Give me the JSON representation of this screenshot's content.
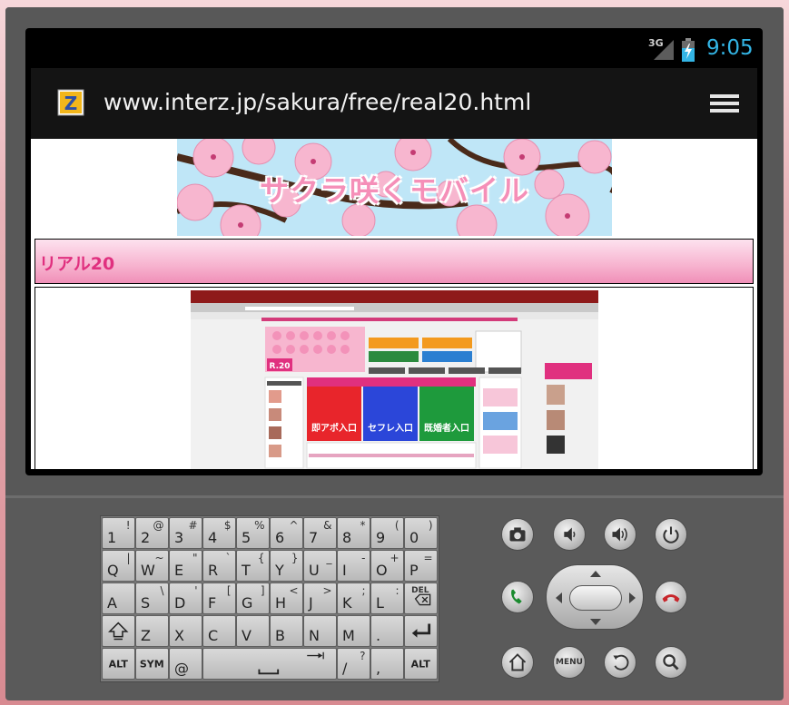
{
  "status_bar": {
    "network": "3G",
    "time": "9:05",
    "clock_color": "#33b5e5"
  },
  "browser": {
    "url": "www.interz.jp/sakura/free/real20.html",
    "site_icon": "interz-favicon-icon",
    "menu_icon": "menu-icon"
  },
  "page": {
    "banner_title": "サクラ咲くモバイル",
    "section_header": "リアル20",
    "section_header_color": "#e0307f",
    "screenshot": {
      "r20_logo": "R.20",
      "tabs": [
        "",
        "",
        "",
        ""
      ],
      "category_labels": [
        "即アポ入口",
        "セフレ入口",
        "既婚者入口"
      ],
      "category_colors": [
        "#e8252b",
        "#2b46d9",
        "#1e9a3c"
      ]
    }
  },
  "keyboard": {
    "row1": [
      [
        "1",
        "!"
      ],
      [
        "2",
        "@"
      ],
      [
        "3",
        "#"
      ],
      [
        "4",
        "$"
      ],
      [
        "5",
        "%"
      ],
      [
        "6",
        "^"
      ],
      [
        "7",
        "&"
      ],
      [
        "8",
        "*"
      ],
      [
        "9",
        "("
      ],
      [
        "0",
        ")"
      ]
    ],
    "row2": [
      [
        "Q",
        "|"
      ],
      [
        "W",
        "~"
      ],
      [
        "E",
        "\""
      ],
      [
        "R",
        "`"
      ],
      [
        "T",
        "{"
      ],
      [
        "Y",
        "}"
      ],
      [
        "U",
        "_"
      ],
      [
        "I",
        "-"
      ],
      [
        "O",
        "+"
      ],
      [
        "P",
        "="
      ]
    ],
    "row3": [
      [
        "A",
        ""
      ],
      [
        "S",
        "\\"
      ],
      [
        "D",
        "'"
      ],
      [
        "F",
        "["
      ],
      [
        "G",
        "]"
      ],
      [
        "H",
        "<"
      ],
      [
        "J",
        ">"
      ],
      [
        "K",
        ";"
      ],
      [
        "L",
        ":"
      ]
    ],
    "row4": [
      "Z",
      "X",
      "C",
      "V",
      "B",
      "N",
      "M",
      "."
    ],
    "del_label": "DEL",
    "alt_label": "ALT",
    "sym_label": "SYM",
    "at_label": "@",
    "slash_key": [
      "/",
      "?"
    ],
    "comma_key": ","
  },
  "hardware": {
    "menu_label": "MENU"
  }
}
